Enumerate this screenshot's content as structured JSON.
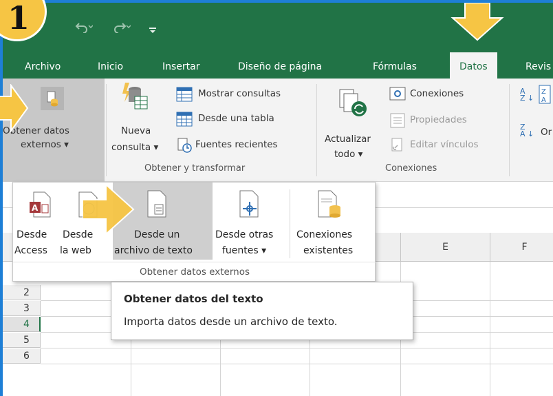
{
  "step_number": "1",
  "quick_access": {
    "save_icon": "save-icon",
    "undo_icon": "undo-icon",
    "redo_icon": "redo-icon",
    "customize_icon": "customize-qat-icon"
  },
  "tabs": [
    {
      "label": "Archivo"
    },
    {
      "label": "Inicio"
    },
    {
      "label": "Insertar"
    },
    {
      "label": "Diseño de página"
    },
    {
      "label": "Fórmulas"
    },
    {
      "label": "Datos"
    },
    {
      "label": "Revis"
    }
  ],
  "ribbon": {
    "obtener_datos": "Obtener datos",
    "externos": "externos",
    "nueva": "Nueva",
    "consulta": "consulta",
    "mostrar_consultas": "Mostrar consultas",
    "desde_tabla": "Desde una tabla",
    "fuentes_recientes": "Fuentes recientes",
    "obtener_transformar": "Obtener y transformar",
    "actualizar": "Actualizar",
    "todo": "todo",
    "conexiones_btn": "Conexiones",
    "propiedades": "Propiedades",
    "editar_vinculos": "Editar vínculos",
    "conexiones_group": "Conexiones",
    "sort_az": "A\nZ",
    "sort_za": "Z\nA",
    "ordenar_partial": "Or"
  },
  "dropdown": {
    "items": [
      {
        "line1": "Desde",
        "line2": "Access"
      },
      {
        "line1": "Desde",
        "line2": "la web"
      },
      {
        "line1": "Desde un",
        "line2": "archivo de texto"
      },
      {
        "line1": "Desde otras",
        "line2": "fuentes"
      },
      {
        "line1": "Conexiones",
        "line2": "existentes"
      }
    ],
    "group_label": "Obtener datos externos"
  },
  "tooltip": {
    "title": "Obtener datos del texto",
    "description": "Importa datos desde un archivo de texto."
  },
  "grid": {
    "columns": [
      "E",
      "F"
    ],
    "rows": [
      "2",
      "3",
      "4",
      "5",
      "6"
    ],
    "selected_row": "4"
  },
  "colors": {
    "excel_green": "#217346",
    "annotation_yellow": "#f6c544",
    "frame_blue": "#1e7fd6"
  }
}
